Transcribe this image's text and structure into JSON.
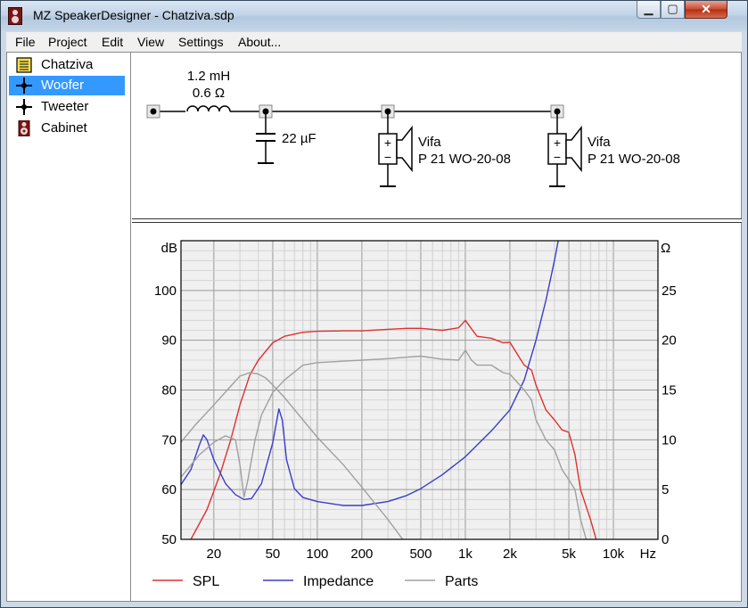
{
  "window": {
    "title": "MZ SpeakerDesigner - Chatziva.sdp",
    "btn_min": "▁",
    "btn_max": "▢",
    "btn_close": "✕"
  },
  "menu": [
    "File",
    "Project",
    "Edit",
    "View",
    "Settings",
    "About..."
  ],
  "tree": [
    {
      "label": "Chatziva",
      "icon": "project-icon"
    },
    {
      "label": "Woofer",
      "icon": "crossover-icon",
      "selected": true
    },
    {
      "label": "Tweeter",
      "icon": "crossover-icon"
    },
    {
      "label": "Cabinet",
      "icon": "cabinet-icon"
    }
  ],
  "schematic": {
    "inductor_value": "1.2 mH",
    "inductor_resistance": "0.6 Ω",
    "capacitor_value": "22 µF",
    "driver1_brand": "Vifa",
    "driver1_model": "P 21 WO-20-08",
    "driver2_brand": "Vifa",
    "driver2_model": "P 21 WO-20-08"
  },
  "colors": {
    "spl": "#e03030",
    "impedance": "#3b3bcc",
    "parts": "#a0a0a0",
    "selection": "#3399ff"
  },
  "chart_data": {
    "type": "line",
    "xscale": "log",
    "xlim": [
      12,
      20000
    ],
    "left_axis_unit": "dB",
    "right_axis_unit": "Ω",
    "x_unit": "Hz",
    "ylim_left": [
      50,
      110
    ],
    "ylim_right": [
      0,
      30
    ],
    "left_ticks": [
      "50",
      "60",
      "70",
      "80",
      "90",
      "100"
    ],
    "right_ticks": [
      "0",
      "5",
      "10",
      "15",
      "20",
      "25"
    ],
    "x_ticks": [
      {
        "v": 20,
        "label": "20"
      },
      {
        "v": 50,
        "label": "50"
      },
      {
        "v": 100,
        "label": "100"
      },
      {
        "v": 200,
        "label": "200"
      },
      {
        "v": 500,
        "label": "500"
      },
      {
        "v": 1000,
        "label": "1k"
      },
      {
        "v": 2000,
        "label": "2k"
      },
      {
        "v": 5000,
        "label": "5k"
      },
      {
        "v": 10000,
        "label": "10k"
      }
    ],
    "grid": true,
    "legend_position": "bottom",
    "series": [
      {
        "name": "SPL",
        "axis": "left",
        "color": "#e03030",
        "x": [
          14,
          18,
          22,
          26,
          30,
          35,
          40,
          50,
          60,
          80,
          100,
          150,
          200,
          300,
          400,
          500,
          700,
          900,
          1000,
          1100,
          1200,
          1500,
          1800,
          2000,
          2500,
          2800,
          3000,
          3500,
          4000,
          4500,
          5000,
          5500,
          6000,
          7000,
          8000
        ],
        "y": [
          50,
          56,
          63,
          70,
          77,
          83,
          86,
          89.5,
          90.8,
          91.6,
          91.8,
          91.9,
          91.9,
          92.2,
          92.4,
          92.4,
          92,
          92.5,
          94,
          92.3,
          90.8,
          90.4,
          89.5,
          89.6,
          85,
          84,
          81,
          76,
          74,
          72,
          71.5,
          67,
          60,
          54,
          48
        ]
      },
      {
        "name": "Impedance",
        "axis": "right",
        "color": "#3b3bcc",
        "x": [
          12,
          14,
          16,
          17,
          18,
          20,
          24,
          28,
          32,
          36,
          42,
          50,
          55,
          58,
          62,
          70,
          80,
          100,
          150,
          200,
          300,
          400,
          500,
          700,
          1000,
          1500,
          2000,
          2500,
          3000,
          3500,
          4000,
          4500,
          5000
        ],
        "y": [
          5.5,
          7,
          9.5,
          10.5,
          10,
          8,
          5.6,
          4.5,
          4.0,
          4.1,
          5.6,
          9.7,
          13.1,
          12,
          8,
          5.1,
          4.2,
          3.8,
          3.4,
          3.4,
          3.8,
          4.4,
          5.1,
          6.5,
          8.3,
          10.9,
          13.0,
          16,
          20,
          24,
          28,
          32,
          37
        ]
      },
      {
        "name": "Parts",
        "axis": "left",
        "color": "#a0a0a0",
        "x": [
          12,
          16,
          20,
          24,
          28,
          30,
          32,
          34,
          38,
          42,
          50,
          60,
          80,
          100,
          150,
          200,
          300,
          400,
          500,
          700,
          900,
          1000,
          1100,
          1200,
          1500,
          1800,
          2000,
          2500,
          2800,
          3000,
          3500,
          4000,
          4500,
          5000,
          5500,
          6000,
          7000
        ],
        "y": [
          62.5,
          67,
          69.5,
          70.8,
          70,
          65,
          58.5,
          62,
          70,
          75,
          79.5,
          82,
          85,
          85.5,
          85.8,
          86,
          86.3,
          86.6,
          86.8,
          86.2,
          86,
          88,
          86,
          85,
          85,
          83.5,
          83.2,
          80,
          78,
          74,
          70,
          68,
          64,
          62,
          60,
          54,
          47
        ]
      },
      {
        "name": "",
        "axis": "left",
        "color": "#a0a0a0",
        "x": [
          12,
          15,
          20,
          25,
          30,
          35,
          40,
          45,
          50,
          60,
          80,
          100,
          150,
          200,
          300,
          400
        ],
        "y": [
          69.5,
          73,
          77,
          80.2,
          82.8,
          83.5,
          83.2,
          82.4,
          81,
          78.5,
          74,
          70.5,
          65,
          60.5,
          54,
          49
        ]
      }
    ]
  },
  "legend": [
    {
      "label": "SPL",
      "color": "#e03030"
    },
    {
      "label": "Impedance",
      "color": "#3b3bcc"
    },
    {
      "label": "Parts",
      "color": "#a0a0a0"
    }
  ]
}
